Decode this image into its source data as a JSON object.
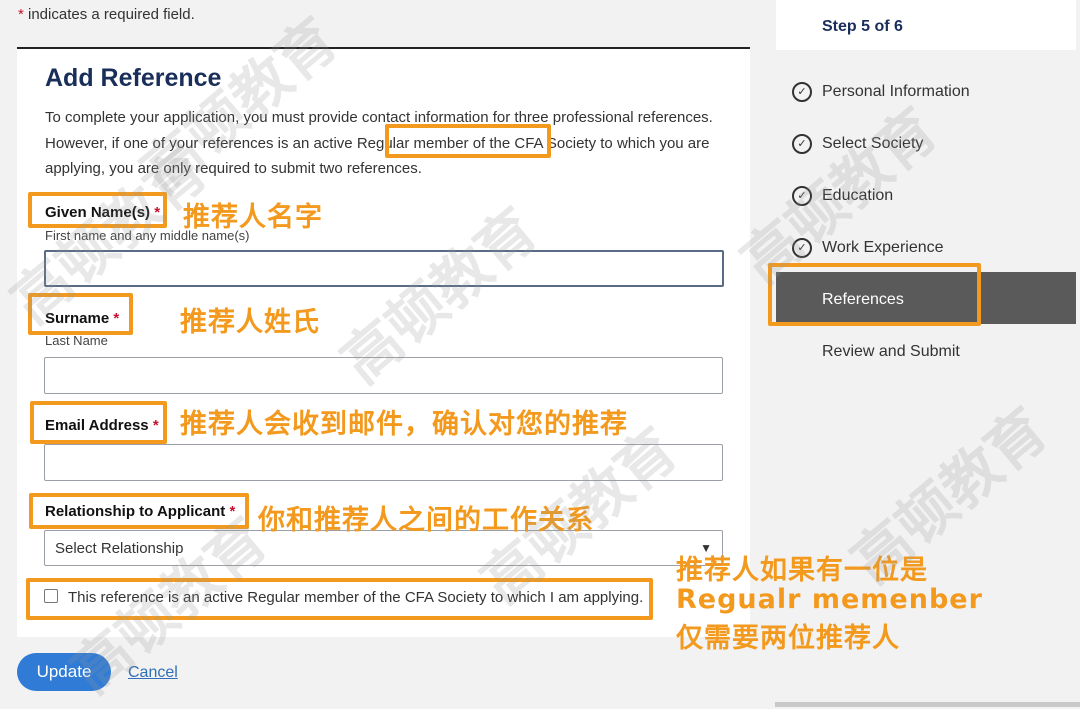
{
  "page": {
    "required_star": "*",
    "required_note": " indicates a required field."
  },
  "form": {
    "title": "Add Reference",
    "intro": "To complete your application, you must provide contact information for three professional references. However, if one of your references is an active Regular member of the CFA Society to which you are applying, you are only required to submit two references.",
    "given_name": {
      "label": "Given Name(s)",
      "star": "*",
      "help": "First name and any middle name(s)",
      "value": ""
    },
    "surname": {
      "label": "Surname",
      "star": "*",
      "help": "Last Name",
      "value": ""
    },
    "email": {
      "label": "Email Address",
      "star": "*",
      "value": ""
    },
    "relationship": {
      "label": "Relationship to Applicant",
      "star": "*",
      "selected": "Select Relationship"
    },
    "member_checkbox": {
      "label": "This reference is an active Regular member of the CFA Society to which I am applying.",
      "checked": false
    },
    "update_label": "Update",
    "cancel_label": "Cancel"
  },
  "stepper": {
    "header": "Step 5 of 6",
    "steps": [
      {
        "label": "Personal Information",
        "status": "complete"
      },
      {
        "label": "Select Society",
        "status": "complete"
      },
      {
        "label": "Education",
        "status": "complete"
      },
      {
        "label": "Work Experience",
        "status": "complete"
      },
      {
        "label": "References",
        "status": "current"
      },
      {
        "label": "Review and Submit",
        "status": "upcoming"
      }
    ]
  },
  "annotations": {
    "given_name": "推荐人名字",
    "surname": "推荐人姓氏",
    "email": "推荐人会收到邮件，确认对您的推荐",
    "relationship": "你和推荐人之间的工作关系",
    "member_line1": "推荐人如果有一位是",
    "member_line2": "Regualr memenber",
    "member_line3": "仅需要两位推荐人"
  },
  "watermark": "高顿教育",
  "colors": {
    "accent": "#2f7bd6",
    "annotation": "#f39a1e",
    "title": "#1a2e5a",
    "required": "#c8102e"
  }
}
